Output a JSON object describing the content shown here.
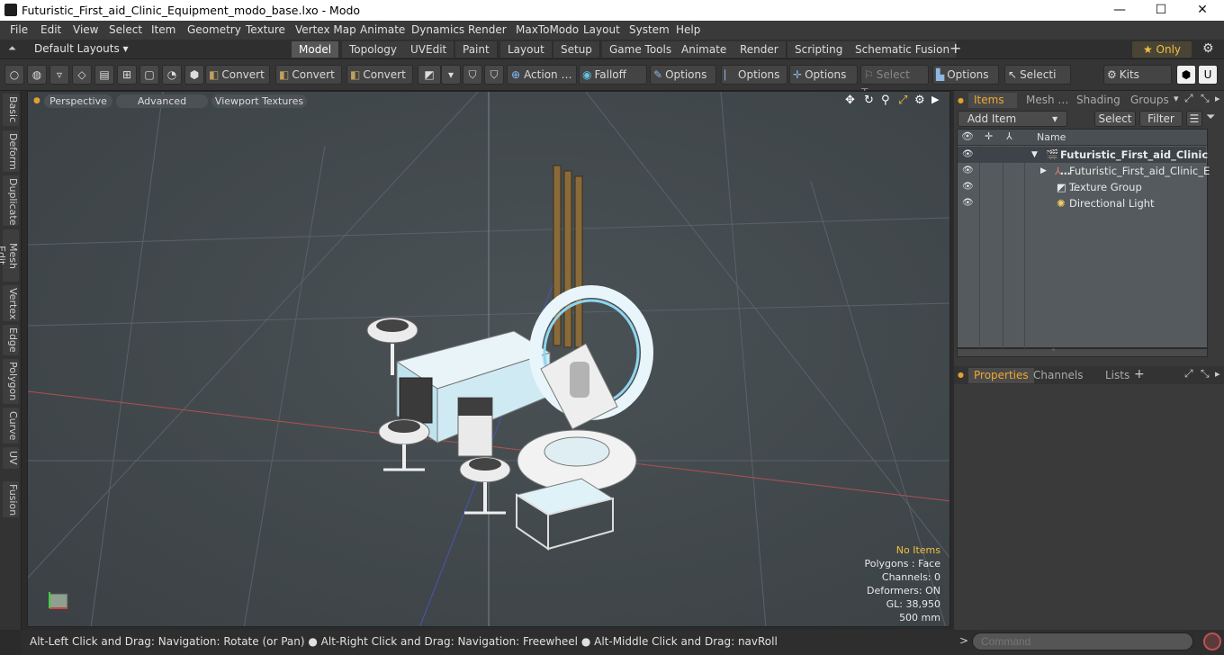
{
  "window": {
    "title": "Futuristic_First_aid_Clinic_Equipment_modo_base.lxo - Modo",
    "minimize": "—",
    "maximize": "☐",
    "close": "✕"
  },
  "menu": [
    "File",
    "Edit",
    "View",
    "Select",
    "Item",
    "Geometry",
    "Texture",
    "Vertex Map",
    "Animate",
    "Dynamics",
    "Render",
    "MaxToModo",
    "Layout",
    "System",
    "Help"
  ],
  "layout": {
    "dropdown": "Default Layouts ▾",
    "tabs": [
      "Model",
      "Topology",
      "UVEdit",
      "Paint",
      "Layout",
      "Setup",
      "Game Tools",
      "Animate",
      "Render",
      "Scripting",
      "Schematic Fusion"
    ],
    "active_tab": "Model",
    "add": "+",
    "only": "★ Only",
    "gear": "⚙"
  },
  "toolbar": {
    "convert1": "Convert",
    "convert2": "Convert",
    "convert3": "Convert",
    "action": "Action",
    "action_more": "…",
    "falloff": "Falloff",
    "options1": "Options",
    "options2": "Options",
    "options3": "Options",
    "select_t": "Select T…",
    "options4": "Options",
    "selecti": "Selecti …",
    "kits": "Kits"
  },
  "left_tabs": [
    "Basic",
    "Deform",
    "Duplicate",
    "Mesh Edit",
    "Vertex",
    "Edge",
    "Polygon",
    "Curve",
    "UV",
    "Fusion"
  ],
  "viewport": {
    "perspective": "Perspective",
    "advanced": "Advanced",
    "textures": "Viewport Textures",
    "stats": {
      "no_items": "No Items",
      "polygons": "Polygons : Face",
      "channels": "Channels: 0",
      "deformers": "Deformers: ON",
      "gl": "GL: 38,950",
      "scale": "500 mm"
    }
  },
  "items_panel": {
    "tabs": [
      "Items",
      "Mesh …",
      "Shading",
      "Groups"
    ],
    "add_item": "Add Item",
    "select": "Select",
    "filter": "Filter",
    "name_col": "Name",
    "rows": [
      {
        "label": "Futuristic_First_aid_Clinic …",
        "bold": true
      },
      {
        "label": "Futuristic_First_aid_Clinic_E …",
        "bold": false
      },
      {
        "label": "Texture Group",
        "bold": false
      },
      {
        "label": "Directional Light",
        "bold": false
      }
    ]
  },
  "properties_panel": {
    "tabs": [
      "Properties",
      "Channels",
      "Lists"
    ],
    "add": "+"
  },
  "status": {
    "hint": "Alt-Left Click and Drag: Navigation: Rotate (or Pan) ● Alt-Right Click and Drag: Navigation: Freewheel ● Alt-Middle Click and Drag: navRoll"
  },
  "command": {
    "placeholder": "Command"
  }
}
